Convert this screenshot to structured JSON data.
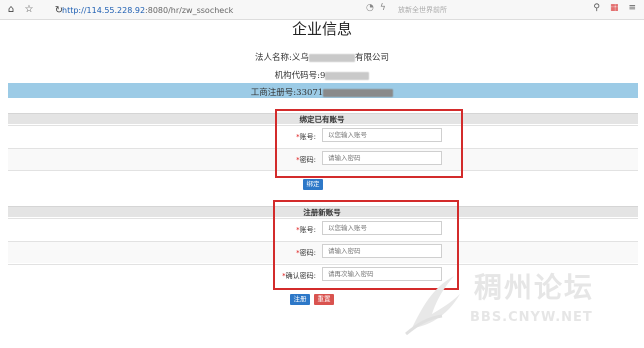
{
  "browser": {
    "url_host": "http://114.55.228.92",
    "url_tail": ":8080/hr/zw_ssocheck",
    "search_placeholder": "放新全世界前所",
    "icons": [
      "home-icon",
      "star-icon",
      "refresh-icon",
      "search-icon",
      "apps-icon",
      "menu-icon"
    ]
  },
  "page": {
    "title": "企业信息",
    "legal_name_label": "法人名称:",
    "legal_name_prefix": "义乌",
    "legal_name_suffix": "有限公司",
    "org_code_label": "机构代码号:",
    "org_code_prefix": "9",
    "reg_no_label": "工商注册号:",
    "reg_no_prefix": "33071"
  },
  "bind_section": {
    "title": "绑定已有账号",
    "account_label": "账号:",
    "account_placeholder": "以您输入账号",
    "password_label": "密码:",
    "password_placeholder": "请输入密码",
    "bind_button": "绑定"
  },
  "register_section": {
    "title": "注册新账号",
    "account_label": "账号:",
    "account_placeholder": "以您输入账号",
    "password_label": "密码:",
    "password_placeholder": "请输入密码",
    "confirm_label": "确认密码:",
    "confirm_placeholder": "请再次输入密码",
    "register_button": "注册",
    "reset_button": "重置"
  },
  "watermark": {
    "text": "稠州论坛",
    "url": "BBS.CNYW.NET"
  },
  "colors": {
    "highlight_red": "#d32b2b",
    "info_bar_blue": "#9ccbe6",
    "button_blue": "#2d78c8",
    "button_red": "#d9534f"
  }
}
